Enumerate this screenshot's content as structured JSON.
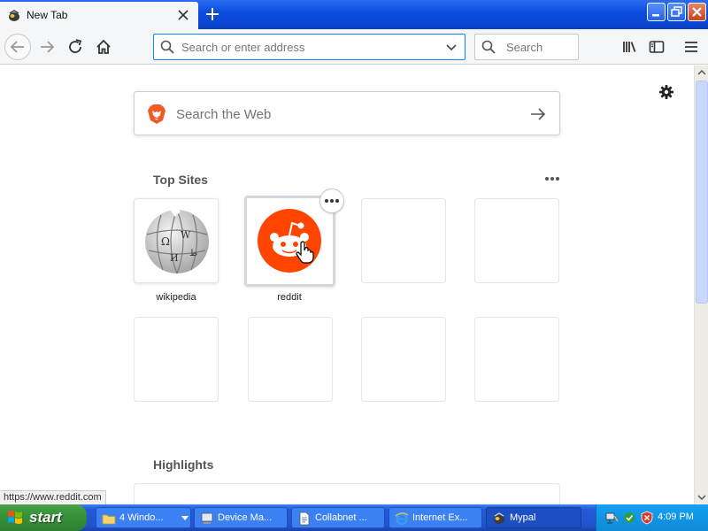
{
  "browser": {
    "tab": {
      "title": "New Tab"
    },
    "urlbar": {
      "placeholder": "Search or enter address"
    },
    "searchbar": {
      "placeholder": "Search"
    }
  },
  "newtab": {
    "websearch": {
      "placeholder": "Search the Web"
    },
    "top_sites": {
      "title": "Top Sites",
      "tiles": [
        {
          "label": "wikipedia"
        },
        {
          "label": "reddit"
        }
      ]
    },
    "highlights": {
      "title": "Highlights"
    },
    "status_url": "https://www.reddit.com"
  },
  "taskbar": {
    "start_label": "start",
    "tasks": [
      {
        "label": "4 Windo..."
      },
      {
        "label": "Device Ma..."
      },
      {
        "label": "Collabnet ..."
      },
      {
        "label": "Internet Ex..."
      },
      {
        "label": "Mypal"
      }
    ],
    "clock": "4:09 PM"
  },
  "colors": {
    "accent": "#0a84ff",
    "reddit": "#ff4500",
    "titlebar": "#0a47d6",
    "taskbar": "#2253cf",
    "start": "#37923a"
  }
}
